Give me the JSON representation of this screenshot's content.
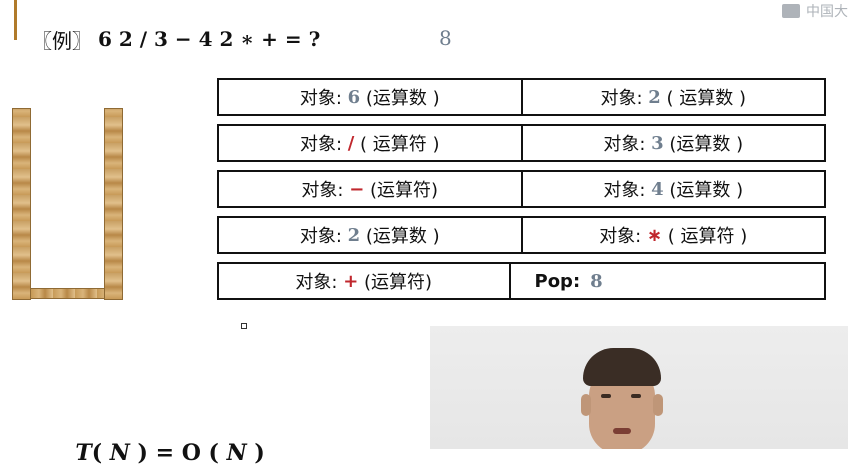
{
  "example": {
    "open_bracket": "〖例〗",
    "expression": "6 2 / 3 − 4 2 ∗ + = ?",
    "answer": "8"
  },
  "watermark": {
    "text": "中国大"
  },
  "objects": [
    {
      "prefix": "对象: ",
      "value": "6",
      "value_kind": "num",
      "suffix": " (运算数 )"
    },
    {
      "prefix": "对象: ",
      "value": "2",
      "value_kind": "num",
      "suffix": " ( 运算数 )"
    },
    {
      "prefix": "对象: ",
      "value": "/",
      "value_kind": "op",
      "suffix": " ( 运算符 )"
    },
    {
      "prefix": "对象: ",
      "value": "3",
      "value_kind": "num",
      "suffix": " (运算数 )"
    },
    {
      "prefix": "对象: ",
      "value": "−",
      "value_kind": "op",
      "suffix": " (运算符)"
    },
    {
      "prefix": "对象: ",
      "value": "4",
      "value_kind": "num",
      "suffix": " (运算数 )"
    },
    {
      "prefix": "对象: ",
      "value": "2",
      "value_kind": "num",
      "suffix": " (运算数 )"
    },
    {
      "prefix": "对象: ",
      "value": "∗",
      "value_kind": "op",
      "suffix": " ( 运算符 )"
    },
    {
      "prefix": "对象: ",
      "value": "+",
      "value_kind": "op",
      "suffix": " (运算符)"
    }
  ],
  "pop": {
    "label": "Pop:",
    "value": "8"
  },
  "complexity": {
    "T": "T",
    "left": "( ",
    "N1": "N",
    "mid": " ) = O ( ",
    "N2": "N",
    "right": " )"
  },
  "colors": {
    "number": "#6f7e8e",
    "operator": "#c0272d",
    "stack_wood": "#c79a57"
  }
}
